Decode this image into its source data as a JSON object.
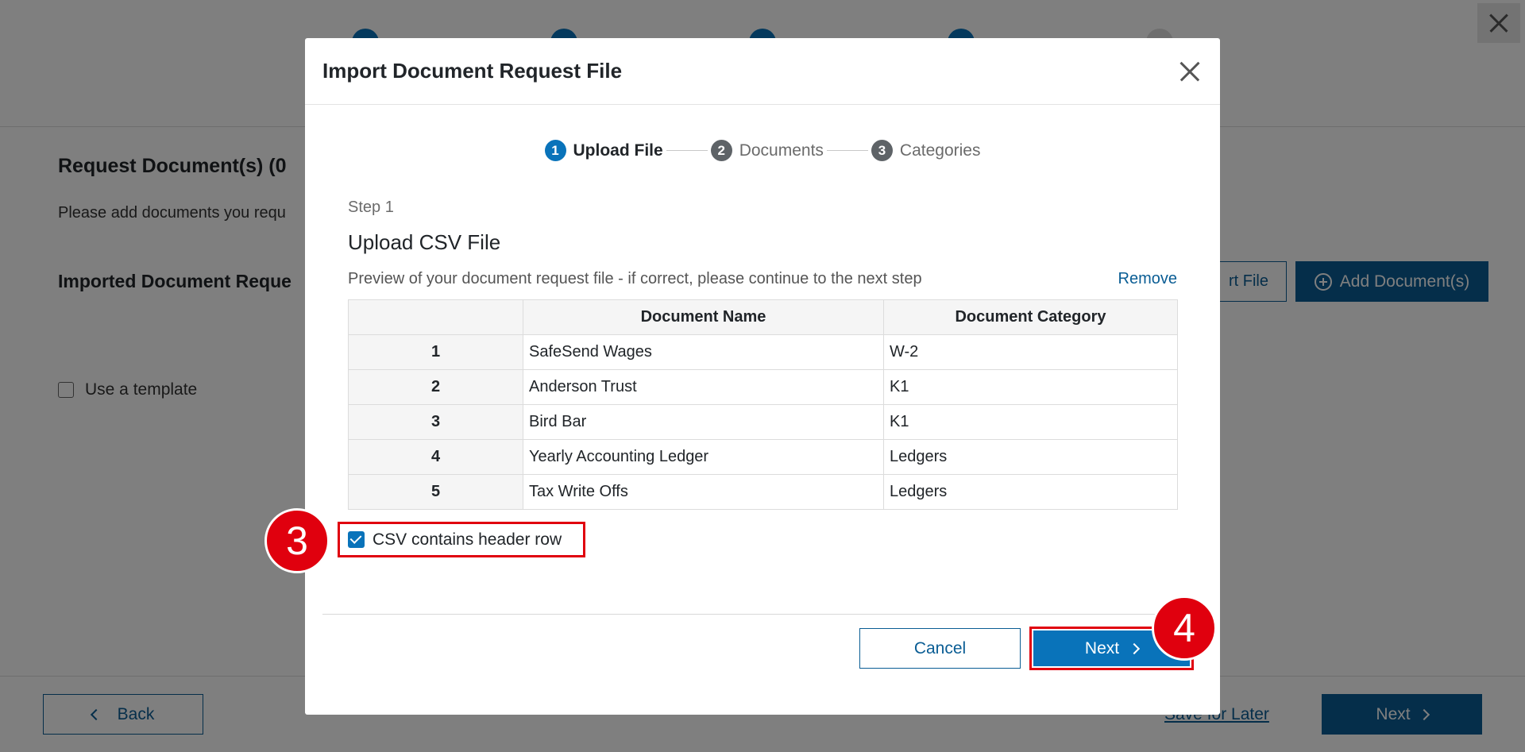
{
  "background": {
    "title": "Request Document(s) (0",
    "subtitle": "Please add documents you requ",
    "imported_heading": "Imported Document Reque",
    "import_file_label": "rt File",
    "add_documents_label": "Add Document(s)",
    "use_template_label": "Use a template",
    "back_label": "Back",
    "save_for_later_label": "Save for Later",
    "next_label": "Next"
  },
  "modal": {
    "title": "Import Document Request File",
    "steps": [
      {
        "num": "1",
        "label": "Upload File"
      },
      {
        "num": "2",
        "label": "Documents"
      },
      {
        "num": "3",
        "label": "Categories"
      }
    ],
    "step_label": "Step 1",
    "upload_title": "Upload CSV File",
    "preview_text": "Preview of your document request file - if correct, please continue to the next step",
    "remove_label": "Remove",
    "table": {
      "headers": [
        "",
        "Document Name",
        "Document Category"
      ],
      "rows": [
        [
          "1",
          "SafeSend Wages",
          "W-2"
        ],
        [
          "2",
          "Anderson Trust",
          "K1"
        ],
        [
          "3",
          "Bird Bar",
          "K1"
        ],
        [
          "4",
          "Yearly Accounting Ledger",
          "Ledgers"
        ],
        [
          "5",
          "Tax Write Offs",
          "Ledgers"
        ]
      ]
    },
    "header_checkbox_label": "CSV contains header row",
    "header_checkbox_checked": true,
    "cancel_label": "Cancel",
    "next_label": "Next"
  },
  "annotations": {
    "badge_3": "3",
    "badge_4": "4"
  },
  "colors": {
    "primary": "#0973ba",
    "annotation_red": "#e0000e"
  }
}
